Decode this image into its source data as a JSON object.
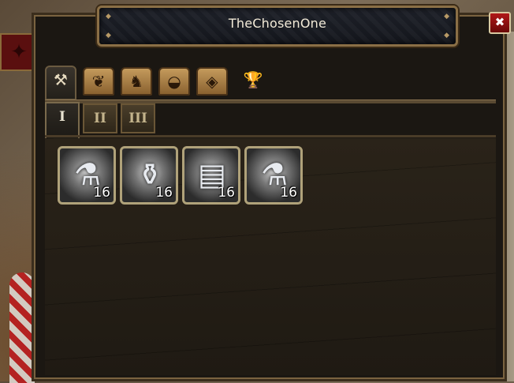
{
  "window": {
    "title": "TheChosenOne",
    "close_label": "✖"
  },
  "tabs": [
    {
      "name": "tools",
      "icon": "⚒",
      "active": true
    },
    {
      "name": "herbs",
      "icon": "❦",
      "active": false
    },
    {
      "name": "animals",
      "icon": "♞",
      "active": false
    },
    {
      "name": "food",
      "icon": "◒",
      "active": false
    },
    {
      "name": "minerals",
      "icon": "◈",
      "active": false
    },
    {
      "name": "trophy",
      "icon": "🏆",
      "active": false
    }
  ],
  "subtabs": [
    {
      "label": "I",
      "active": true
    },
    {
      "label": "II",
      "active": false
    },
    {
      "label": "III",
      "active": false
    }
  ],
  "items": [
    {
      "name": "round-flask",
      "icon": "⚗",
      "count": "16"
    },
    {
      "name": "glass-vase",
      "icon": "⚱",
      "count": "16"
    },
    {
      "name": "paper-sheets",
      "icon": "▤",
      "count": "16"
    },
    {
      "name": "stone-potion",
      "icon": "⚗",
      "count": "16"
    }
  ]
}
